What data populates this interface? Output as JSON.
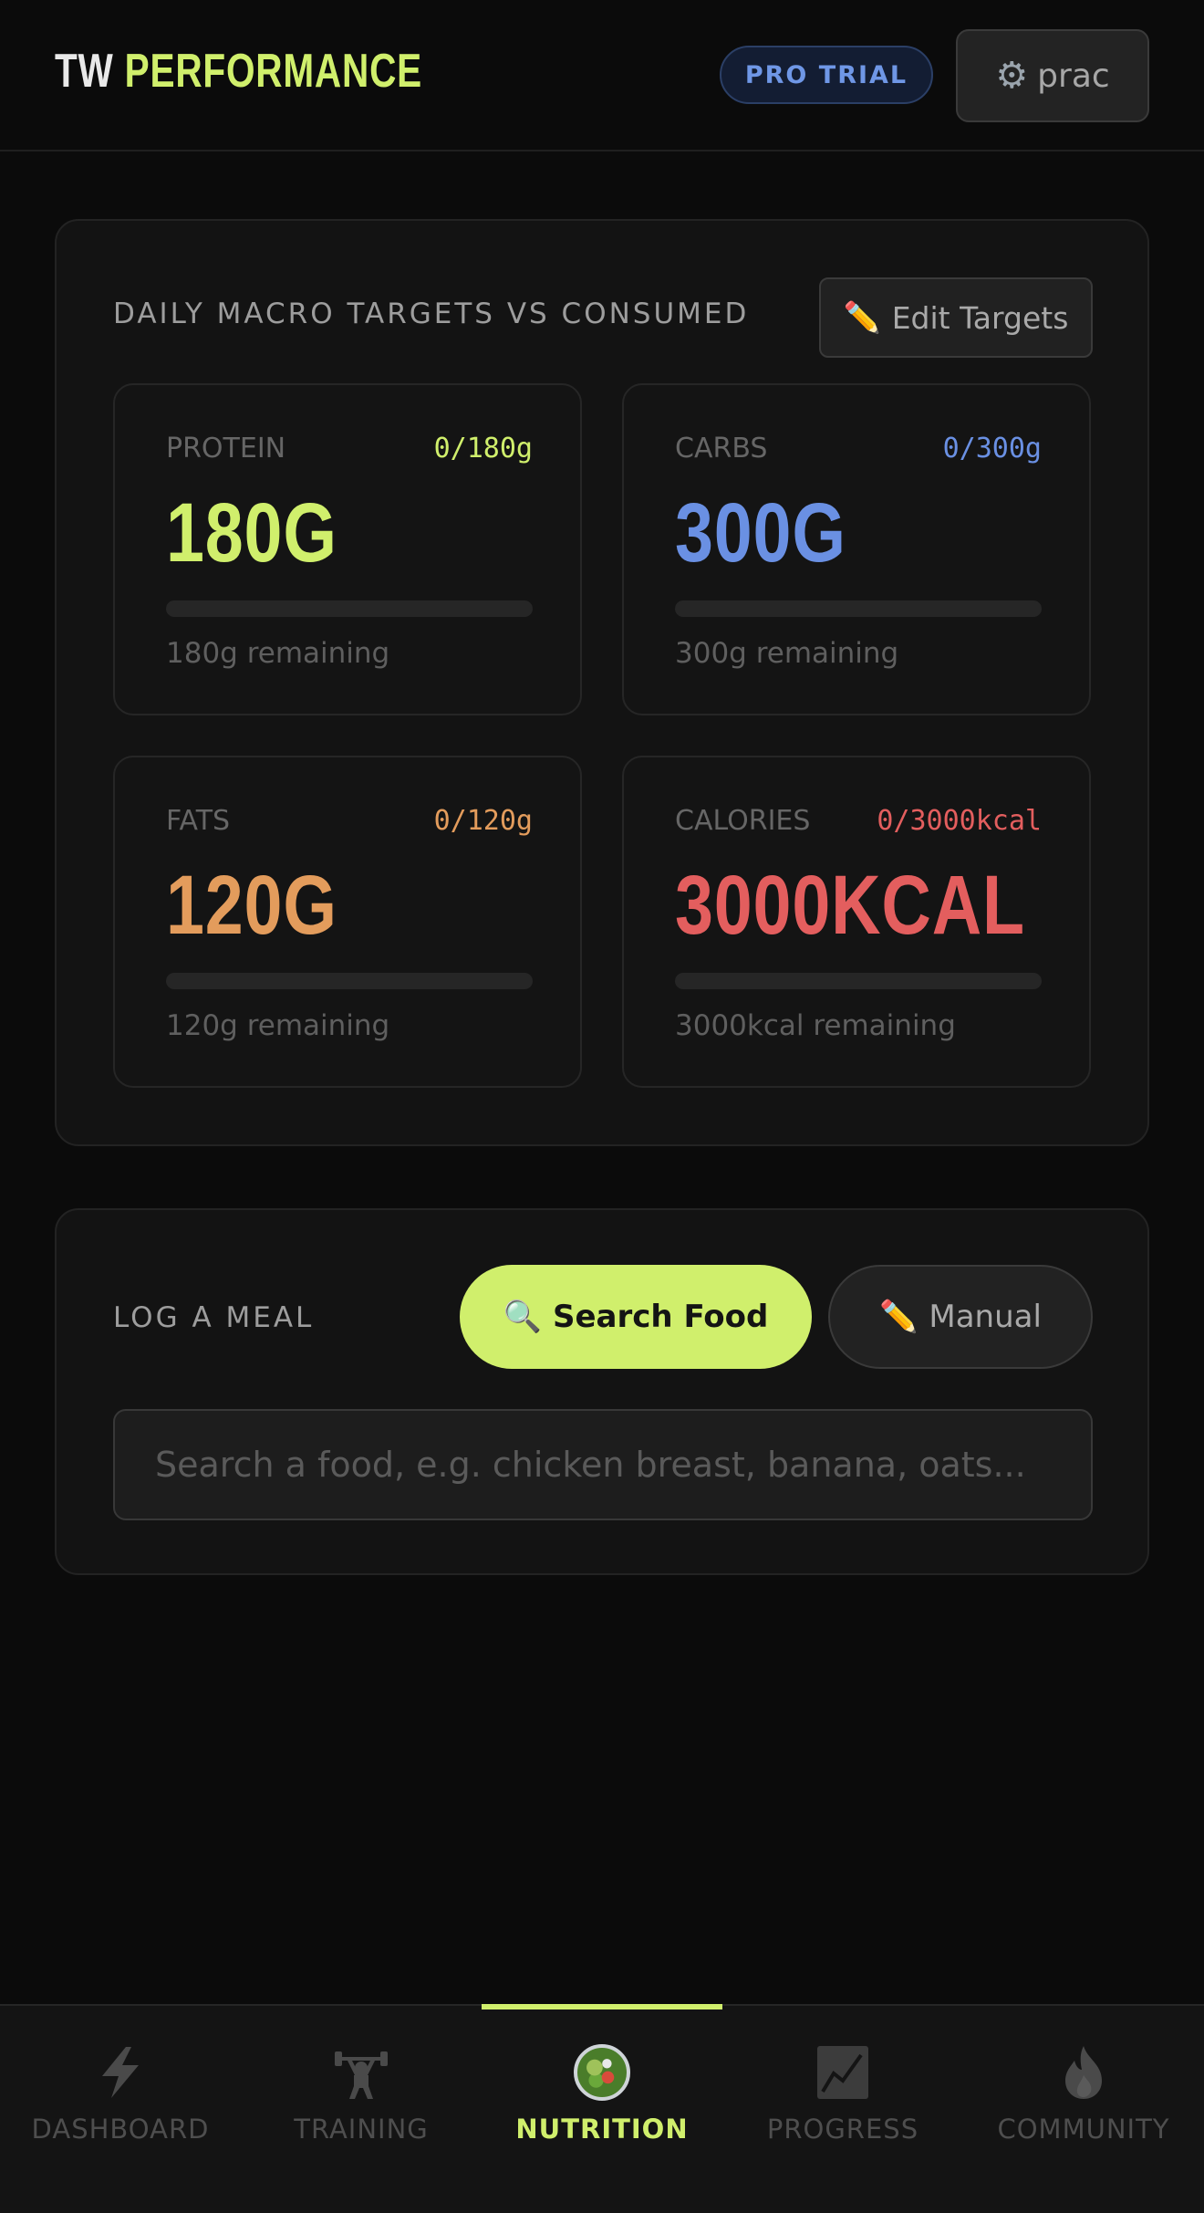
{
  "header": {
    "brand_part1": "TW",
    "brand_part2": "PERFORMANCE",
    "badge": "PRO TRIAL",
    "user_name": "prac"
  },
  "macros": {
    "title": "DAILY MACRO TARGETS VS CONSUMED",
    "edit_label": "Edit Targets",
    "items": [
      {
        "label": "PROTEIN",
        "ratio": "0/180g",
        "big": "180G",
        "remaining": "180g remaining",
        "progress": 0,
        "color": "#d0ef6c"
      },
      {
        "label": "CARBS",
        "ratio": "0/300g",
        "big": "300G",
        "remaining": "300g remaining",
        "progress": 0,
        "color": "#6a90e3"
      },
      {
        "label": "FATS",
        "ratio": "0/120g",
        "big": "120G",
        "remaining": "120g remaining",
        "progress": 0,
        "color": "#e39c5c"
      },
      {
        "label": "CALORIES",
        "ratio": "0/3000kcal",
        "big": "3000KCAL",
        "remaining": "3000kcal remaining",
        "progress": 0,
        "color": "#e35e5e"
      }
    ]
  },
  "log_meal": {
    "title": "LOG A MEAL",
    "search_food_label": "Search Food",
    "manual_label": "Manual",
    "search_placeholder": "Search a food, e.g. chicken breast, banana, oats..."
  },
  "nav": {
    "items": [
      {
        "label": "DASHBOARD",
        "icon": "lightning-icon"
      },
      {
        "label": "TRAINING",
        "icon": "weightlifter-icon"
      },
      {
        "label": "NUTRITION",
        "icon": "salad-icon",
        "active": true
      },
      {
        "label": "PROGRESS",
        "icon": "chart-icon"
      },
      {
        "label": "COMMUNITY",
        "icon": "fire-icon"
      }
    ]
  }
}
